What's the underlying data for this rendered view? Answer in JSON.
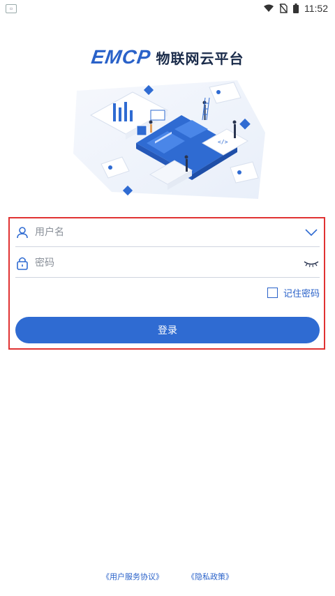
{
  "status_bar": {
    "time": "11:52"
  },
  "brand": {
    "logo_text": "EMCP",
    "name": "物联网云平台"
  },
  "login_form": {
    "username": {
      "placeholder": "用户名",
      "value": ""
    },
    "password": {
      "placeholder": "密码",
      "value": ""
    },
    "remember_label": "记住密码",
    "remember_checked": false,
    "login_label": "登录"
  },
  "footer": {
    "agreement_link": "《用户服务协议》",
    "privacy_link": "《隐私政策》"
  },
  "colors": {
    "accent": "#2f6bd2",
    "frame": "#e03232"
  },
  "icons": {
    "username": "user-icon",
    "username_toggle": "chevron-down-icon",
    "password": "lock-icon",
    "password_toggle": "eye-closed-icon"
  }
}
